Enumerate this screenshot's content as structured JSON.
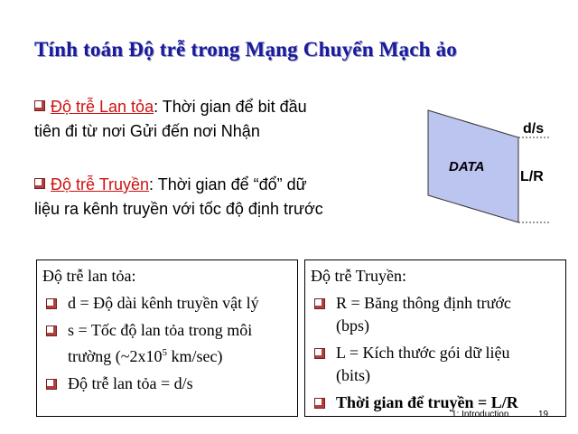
{
  "title": "Tính toán Độ trễ trong Mạng Chuyển Mạch ảo",
  "propagation": {
    "term": "Độ trễ Lan tỏa",
    "desc_line1": ": Thời gian để bit đầu",
    "desc_line2": "tiên đi từ nơi Gửi đến nơi Nhận"
  },
  "transmission": {
    "term": "Độ trễ Truyền",
    "desc_line1": ": Thời gian để “đổ” dữ",
    "desc_line2": "liệu ra kênh truyền với tốc độ định trước"
  },
  "diagram": {
    "data_label": "DATA",
    "top_label": "d/s",
    "side_label": "L/R",
    "fill_color": "#bcc4f0"
  },
  "left_box": {
    "heading": "Độ trễ lan tỏa:",
    "item1": "d = Độ dài kênh truyền vật lý",
    "item2_line1": "s = Tốc độ lan tỏa trong môi",
    "item2_line2_pre": "trường (~2x10",
    "item2_sup": "5",
    "item2_line2_post": " km/sec)",
    "item3": "Độ trễ lan tỏa = d/s"
  },
  "right_box": {
    "heading": "Độ trễ Truyền:",
    "item1_line1": "R = Băng thông định trước",
    "item1_line2": "(bps)",
    "item2_line1": "L = Kích thước gói dữ liệu",
    "item2_line2": "(bits)",
    "item3": "Thời gian để truyền  = L/R"
  },
  "footer": {
    "section": "1: Introduction",
    "page": "19"
  }
}
